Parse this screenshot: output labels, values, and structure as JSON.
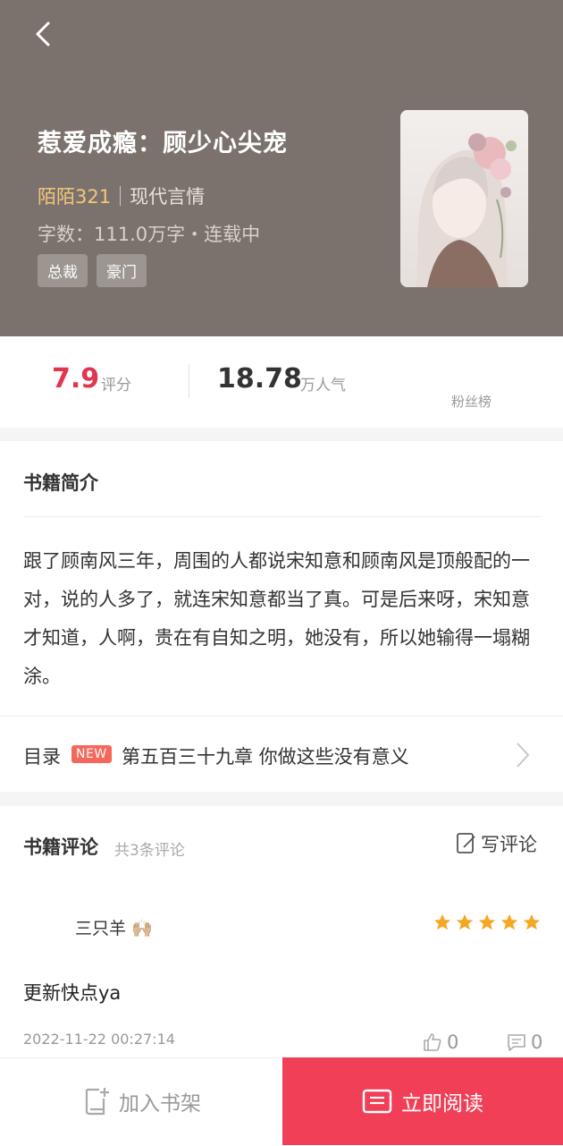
{
  "header": {
    "title": "惹爱成瘾：顾少心尖宠",
    "author": "陌陌321",
    "category": "现代言情",
    "meta": "字数：111.0万字・连载中",
    "tags": [
      "总裁",
      "豪门"
    ]
  },
  "stats": {
    "score": "7.9",
    "score_label": "评分",
    "popularity": "18.78",
    "popularity_label": "万人气",
    "fans_label": "粉丝榜"
  },
  "intro": {
    "title": "书籍简介",
    "text": "跟了顾南风三年，周围的人都说宋知意和顾南风是顶般配的一对，说的人多了，就连宋知意都当了真。可是后来呀，宋知意才知道，人啊，贵在有自知之明，她没有，所以她输得一塌糊涂。"
  },
  "toc": {
    "label": "目录",
    "badge": "NEW",
    "latest_chapter": "第五百三十九章 你做这些没有意义"
  },
  "reviews": {
    "title": "书籍评论",
    "count_text": "共3条评论",
    "write_label": "写评论",
    "items": [
      {
        "user": "三只羊 🙌🏼",
        "rating": 5,
        "content": "更新快点ya",
        "date": "2022-11-22 00:27:14",
        "likes": "0",
        "replies": "0"
      }
    ]
  },
  "bottom_bar": {
    "add_shelf_label": "加入书架",
    "read_now_label": "立即阅读"
  },
  "colors": {
    "header_bg": "#7b726d",
    "accent": "#f13f58",
    "score": "#e0364e",
    "author": "#f3c77a",
    "star": "#f5a623"
  }
}
